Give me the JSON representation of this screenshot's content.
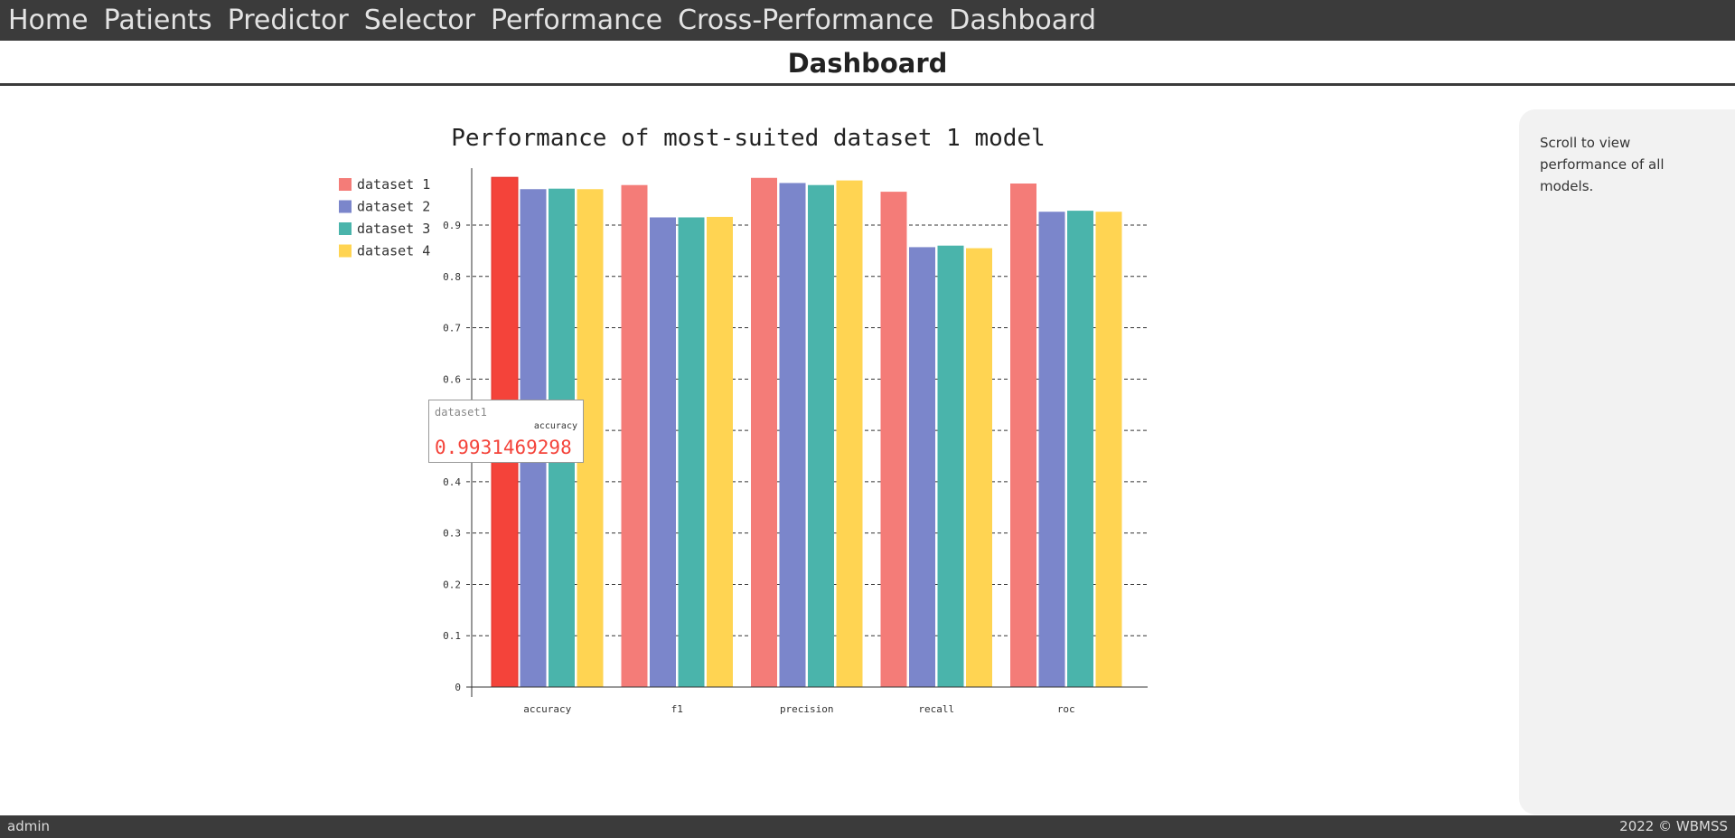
{
  "nav": {
    "items": [
      "Home",
      "Patients",
      "Predictor",
      "Selector",
      "Performance",
      "Cross-Performance",
      "Dashboard"
    ]
  },
  "page": {
    "title": "Dashboard"
  },
  "side_panel": {
    "text": "Scroll to view performance of all models."
  },
  "footer": {
    "user": "admin",
    "copyright": "2022 © WBMSS"
  },
  "tooltip": {
    "series": "dataset1",
    "metric": "accuracy",
    "value": "0.9931469298"
  },
  "colors": {
    "dataset1": "#f47c78",
    "dataset2": "#7b86cb",
    "dataset3": "#4ab4ab",
    "dataset4": "#ffd452",
    "highlight": "#f4433a"
  },
  "chart_data": {
    "type": "bar",
    "title": "Performance of most-suited dataset 1 model",
    "categories": [
      "accuracy",
      "f1",
      "precision",
      "recall",
      "roc"
    ],
    "series": [
      {
        "name": "dataset 1",
        "values": [
          0.993,
          0.978,
          0.992,
          0.965,
          0.981
        ]
      },
      {
        "name": "dataset 2",
        "values": [
          0.97,
          0.915,
          0.982,
          0.857,
          0.926
        ]
      },
      {
        "name": "dataset 3",
        "values": [
          0.971,
          0.915,
          0.978,
          0.86,
          0.928
        ]
      },
      {
        "name": "dataset 4",
        "values": [
          0.97,
          0.916,
          0.987,
          0.855,
          0.926
        ]
      }
    ],
    "ylim": [
      0,
      1
    ],
    "yticks": [
      "0",
      "0.1",
      "0.2",
      "0.3",
      "0.4",
      "0.5",
      "0.6",
      "0.7",
      "0.8",
      "0.9"
    ],
    "grid": true,
    "legend_position": "top-left",
    "highlighted": {
      "series": 0,
      "category": 0
    }
  }
}
